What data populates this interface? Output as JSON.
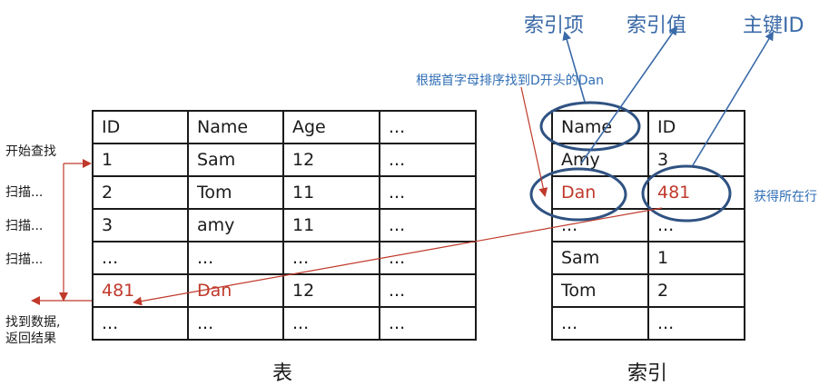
{
  "top_labels": {
    "index_item": "索引项",
    "index_value": "索引值",
    "primary_key": "主键ID"
  },
  "sort_note": "根据首字母排序找到D开头的Dan",
  "found_row_note": "获得所在行",
  "side_steps": {
    "start": "开始查找",
    "scan": "扫描...",
    "found": "找到数据,\n返回结果"
  },
  "table": {
    "caption": "表",
    "rows": [
      [
        "ID",
        "Name",
        "Age",
        "..."
      ],
      [
        "1",
        "Sam",
        "12",
        "..."
      ],
      [
        "2",
        "Tom",
        "11",
        "..."
      ],
      [
        "3",
        "amy",
        "11",
        "..."
      ],
      [
        "...",
        "...",
        "...",
        "..."
      ],
      [
        "481",
        "Dan",
        "12",
        "..."
      ],
      [
        "...",
        "...",
        "...",
        "..."
      ]
    ]
  },
  "index": {
    "caption": "索引",
    "rows": [
      [
        "Name",
        "ID"
      ],
      [
        "Amy",
        "3"
      ],
      [
        "Dan",
        "481"
      ],
      [
        "...",
        "..."
      ],
      [
        "Sam",
        "1"
      ],
      [
        "Tom",
        "2"
      ],
      [
        "...",
        "..."
      ]
    ]
  },
  "colors": {
    "blue": "#3a6aa8",
    "red": "#c0392b",
    "ellipse": "#2f5282"
  }
}
